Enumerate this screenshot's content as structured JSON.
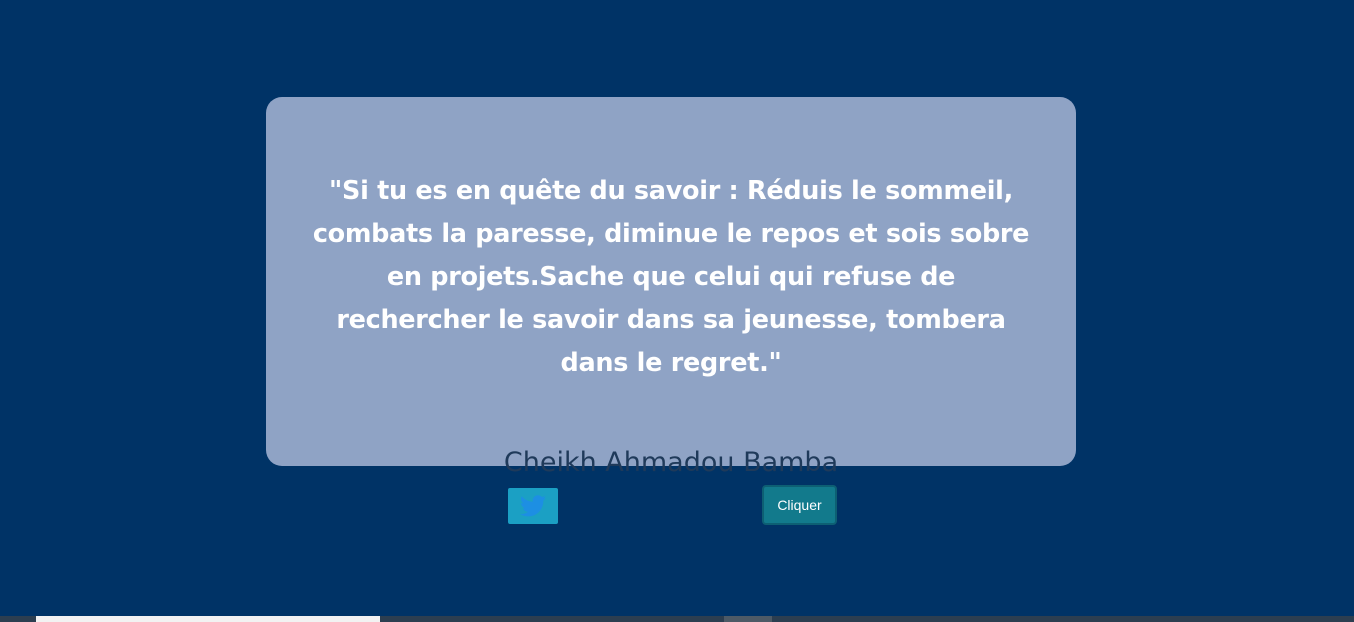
{
  "quote": {
    "text": "\"Si tu es en quête du savoir : Réduis le sommeil, combats la paresse, diminue le repos et sois sobre en projets.Sache que celui qui refuse de rechercher le savoir dans sa jeunesse, tombera dans le regret.\"",
    "author": "Cheikh Ahmadou Bamba"
  },
  "actions": {
    "tweet_icon": "twitter-bird-icon",
    "click_label": "Cliquer"
  },
  "colors": {
    "background": "#003366",
    "card": "#8fa3c5",
    "quote_text": "#ffffff",
    "author_text": "#1f3a5a",
    "tweet_button": "#1ba0c4",
    "click_button": "#127a8c"
  }
}
